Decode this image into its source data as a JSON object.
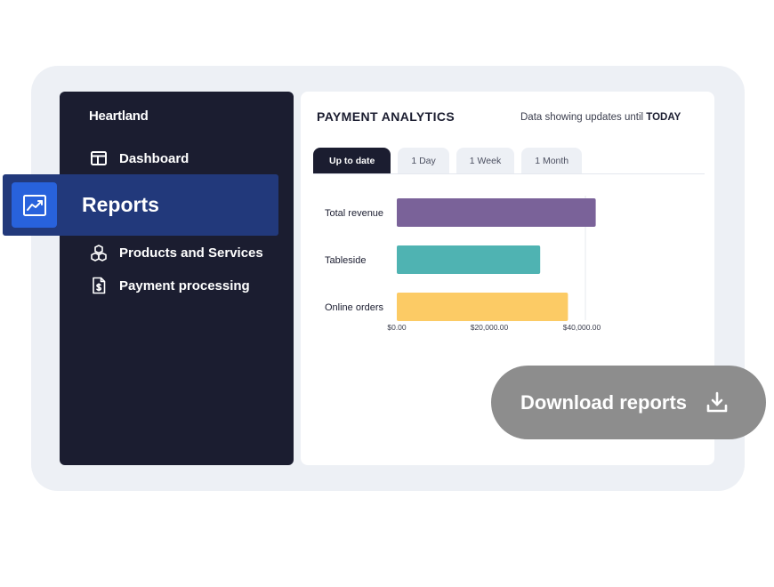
{
  "sidebar": {
    "brand": "Heartland",
    "items": [
      {
        "label": "Dashboard",
        "icon": "layout-icon"
      },
      {
        "label": "Reports",
        "icon": "trending-chart-icon",
        "active": true
      },
      {
        "label": "Products and Services",
        "icon": "boxes-icon"
      },
      {
        "label": "Payment processing",
        "icon": "dollar-document-icon"
      }
    ]
  },
  "panel": {
    "title": "PAYMENT ANALYTICS",
    "note_prefix": "Data showing updates until",
    "note_emphasis": "TODAY",
    "tabs": [
      {
        "label": "Up to date",
        "active": true
      },
      {
        "label": "1 Day",
        "active": false
      },
      {
        "label": "1 Week",
        "active": false
      },
      {
        "label": "1 Month",
        "active": false
      }
    ]
  },
  "chart_data": {
    "type": "bar",
    "orientation": "horizontal",
    "categories": [
      "Total revenue",
      "Tableside",
      "Online orders"
    ],
    "values": [
      43000,
      31000,
      37000
    ],
    "colors": [
      "#7a6299",
      "#4fb3b2",
      "#fccb65"
    ],
    "xticks": [
      "$0.00",
      "$20,000.00",
      "$40,000.00"
    ],
    "xlim": [
      0,
      40000
    ]
  },
  "download": {
    "label": "Download reports",
    "icon": "download-icon"
  },
  "colors": {
    "sidebar_bg": "#1b1d30",
    "highlight_bg": "#22397b",
    "accent": "#2862dc",
    "button_bg": "#8d8d8d"
  }
}
